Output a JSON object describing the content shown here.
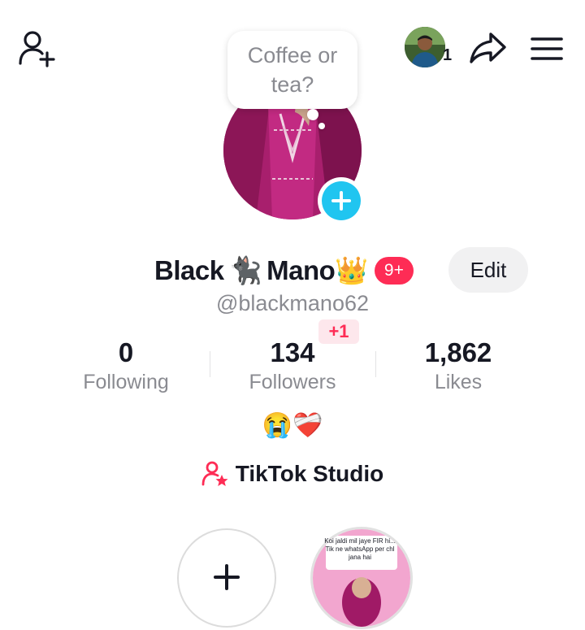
{
  "header": {
    "add_friend_icon": "person-add-icon",
    "avatar_count": "1",
    "share_icon": "share-arrow-icon",
    "menu_icon": "hamburger-menu-icon"
  },
  "note": {
    "text": "Coffee or tea?"
  },
  "profile": {
    "name_part1": "Black",
    "name_emoji1": "🐈‍⬛",
    "name_part2": "Mano",
    "name_emoji2": "👑",
    "badge": "9+",
    "edit_label": "Edit",
    "username": "@blackmano62"
  },
  "stats": {
    "following": {
      "value": "0",
      "label": "Following"
    },
    "followers": {
      "value": "134",
      "label": "Followers",
      "delta": "+1"
    },
    "likes": {
      "value": "1,862",
      "label": "Likes"
    }
  },
  "bio": "😭❤️‍🩹",
  "studio": {
    "label": "TikTok Studio",
    "icon": "person-star-icon"
  },
  "stories": {
    "add_icon": "plus-icon",
    "thumb_text": "Koi jaldi mil jaye FIR hi... Tik ne whatsApp per chl jana hai"
  },
  "colors": {
    "accent": "#fe2c55",
    "add_button": "#20c5f0",
    "secondary_text": "#8a8b91"
  }
}
